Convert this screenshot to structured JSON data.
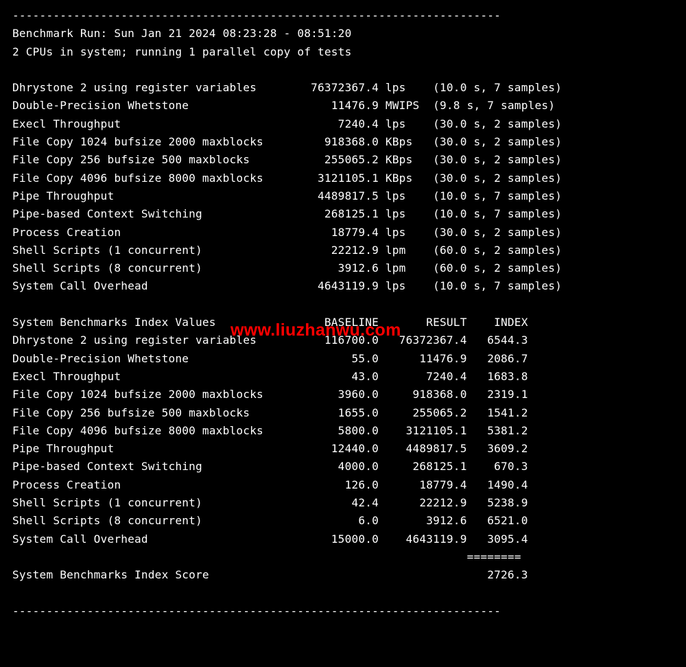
{
  "hr": "------------------------------------------------------------------------",
  "header": {
    "run_line": "Benchmark Run: Sun Jan 21 2024 08:23:28 - 08:51:20",
    "cpu_line": "2 CPUs in system; running 1 parallel copy of tests"
  },
  "tests": [
    {
      "name": "Dhrystone 2 using register variables",
      "value": "76372367.4",
      "unit": "lps",
      "timing": "(10.0 s, 7 samples)"
    },
    {
      "name": "Double-Precision Whetstone",
      "value": "11476.9",
      "unit": "MWIPS",
      "timing": "(9.8 s, 7 samples)"
    },
    {
      "name": "Execl Throughput",
      "value": "7240.4",
      "unit": "lps",
      "timing": "(30.0 s, 2 samples)"
    },
    {
      "name": "File Copy 1024 bufsize 2000 maxblocks",
      "value": "918368.0",
      "unit": "KBps",
      "timing": "(30.0 s, 2 samples)"
    },
    {
      "name": "File Copy 256 bufsize 500 maxblocks",
      "value": "255065.2",
      "unit": "KBps",
      "timing": "(30.0 s, 2 samples)"
    },
    {
      "name": "File Copy 4096 bufsize 8000 maxblocks",
      "value": "3121105.1",
      "unit": "KBps",
      "timing": "(30.0 s, 2 samples)"
    },
    {
      "name": "Pipe Throughput",
      "value": "4489817.5",
      "unit": "lps",
      "timing": "(10.0 s, 7 samples)"
    },
    {
      "name": "Pipe-based Context Switching",
      "value": "268125.1",
      "unit": "lps",
      "timing": "(10.0 s, 7 samples)"
    },
    {
      "name": "Process Creation",
      "value": "18779.4",
      "unit": "lps",
      "timing": "(30.0 s, 2 samples)"
    },
    {
      "name": "Shell Scripts (1 concurrent)",
      "value": "22212.9",
      "unit": "lpm",
      "timing": "(60.0 s, 2 samples)"
    },
    {
      "name": "Shell Scripts (8 concurrent)",
      "value": "3912.6",
      "unit": "lpm",
      "timing": "(60.0 s, 2 samples)"
    },
    {
      "name": "System Call Overhead",
      "value": "4643119.9",
      "unit": "lps",
      "timing": "(10.0 s, 7 samples)"
    }
  ],
  "index_header": {
    "title": "System Benchmarks Index Values",
    "col_baseline": "BASELINE",
    "col_result": "RESULT",
    "col_index": "INDEX"
  },
  "index_rows": [
    {
      "name": "Dhrystone 2 using register variables",
      "baseline": "116700.0",
      "result": "76372367.4",
      "index": "6544.3"
    },
    {
      "name": "Double-Precision Whetstone",
      "baseline": "55.0",
      "result": "11476.9",
      "index": "2086.7"
    },
    {
      "name": "Execl Throughput",
      "baseline": "43.0",
      "result": "7240.4",
      "index": "1683.8"
    },
    {
      "name": "File Copy 1024 bufsize 2000 maxblocks",
      "baseline": "3960.0",
      "result": "918368.0",
      "index": "2319.1"
    },
    {
      "name": "File Copy 256 bufsize 500 maxblocks",
      "baseline": "1655.0",
      "result": "255065.2",
      "index": "1541.2"
    },
    {
      "name": "File Copy 4096 bufsize 8000 maxblocks",
      "baseline": "5800.0",
      "result": "3121105.1",
      "index": "5381.2"
    },
    {
      "name": "Pipe Throughput",
      "baseline": "12440.0",
      "result": "4489817.5",
      "index": "3609.2"
    },
    {
      "name": "Pipe-based Context Switching",
      "baseline": "4000.0",
      "result": "268125.1",
      "index": "670.3"
    },
    {
      "name": "Process Creation",
      "baseline": "126.0",
      "result": "18779.4",
      "index": "1490.4"
    },
    {
      "name": "Shell Scripts (1 concurrent)",
      "baseline": "42.4",
      "result": "22212.9",
      "index": "5238.9"
    },
    {
      "name": "Shell Scripts (8 concurrent)",
      "baseline": "6.0",
      "result": "3912.6",
      "index": "6521.0"
    },
    {
      "name": "System Call Overhead",
      "baseline": "15000.0",
      "result": "4643119.9",
      "index": "3095.4"
    }
  ],
  "score_rule": "                                                                   ========",
  "score_line": {
    "label": "System Benchmarks Index Score",
    "value": "2726.3"
  },
  "watermark": "www.liuzhanwu.com"
}
